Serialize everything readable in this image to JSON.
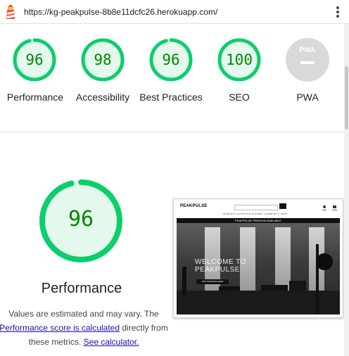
{
  "address_bar": {
    "url": "https://kg-peakpulse-8b8e11dcfc26.herokuapp.com/",
    "logo_icon": "lighthouse-icon",
    "menu_icon": "more-vert-icon"
  },
  "scores": [
    {
      "label": "Performance",
      "value": "96",
      "fraction": 0.96
    },
    {
      "label": "Accessibility",
      "value": "98",
      "fraction": 0.98
    },
    {
      "label": "Best Practices",
      "value": "96",
      "fraction": 0.96
    },
    {
      "label": "SEO",
      "value": "100",
      "fraction": 1.0
    },
    {
      "label": "PWA",
      "value": "",
      "fraction": 0
    }
  ],
  "pwa_badge_text": "PWA",
  "performance": {
    "score": "96",
    "fraction": 0.96,
    "title": "Performance",
    "desc_part1": "Values are estimated and may vary. The",
    "desc_link1": "Performance score is calculated",
    "desc_part2": "directly from these metrics.",
    "desc_link2": "See calculator."
  },
  "screenshot": {
    "logo": "PEAKPULSE",
    "menu": "WORKOUT   NUTRITION   MINDSET   COMMUNITY   SHOP",
    "banner": "PEAKPULSE PREMIUM AVAILABLE",
    "hero_line1": "WELCOME TO",
    "hero_line2": "PEAKPULSE",
    "cta": "JOIN PREMIUM HERE"
  },
  "colors": {
    "pass_green": "#0cce6b",
    "pass_fill": "#e5f8ed",
    "score_text": "#008800",
    "pwa_grey": "#d9d9d9",
    "link_blue": "#1a0dab"
  }
}
